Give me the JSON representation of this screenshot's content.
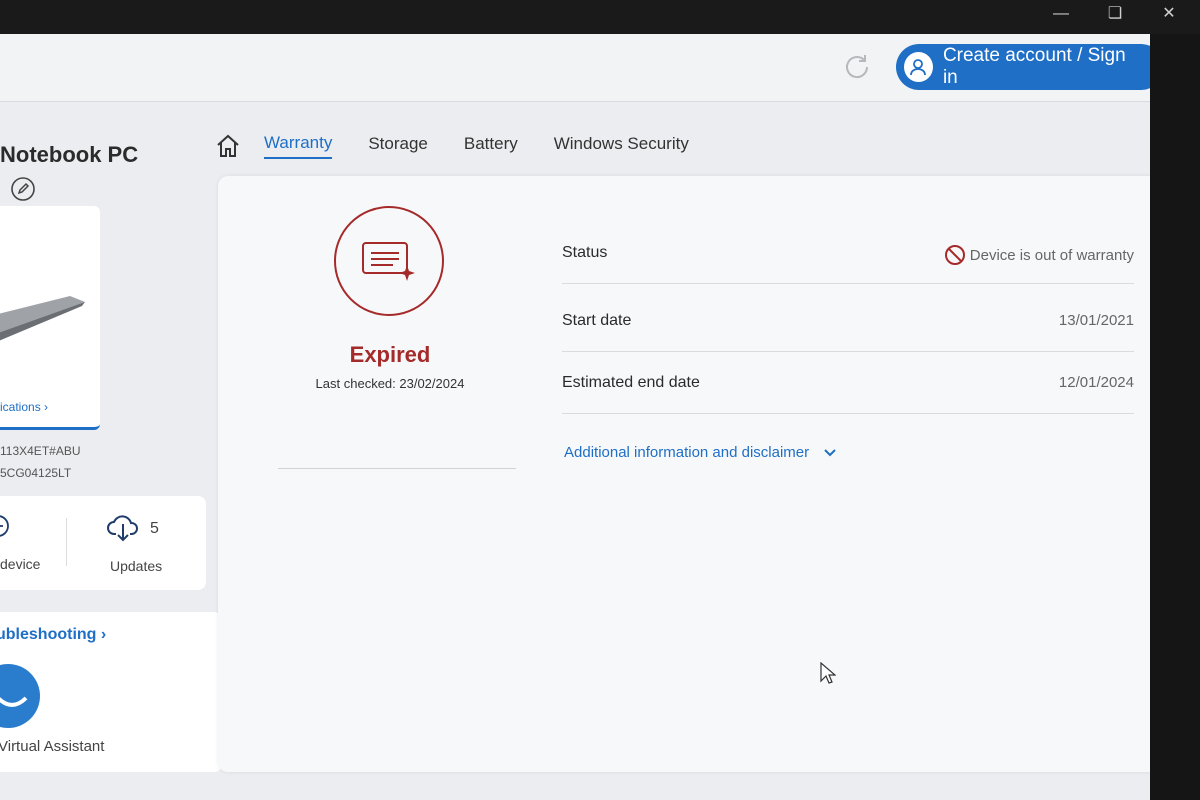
{
  "header": {
    "account_button": "Create account / Sign in"
  },
  "device": {
    "title": "Notebook PC",
    "specs_link": "ications ›",
    "product_number": "113X4ET#ABU",
    "serial_number": "5CG04125LT"
  },
  "tiles": {
    "add_device_label": "device",
    "updates_label": "Updates",
    "updates_count": "5"
  },
  "troubleshooting": {
    "title": "ubleshooting ›",
    "virtual_assistant": "Virtual Assistant"
  },
  "tabs": [
    {
      "label": "Warranty",
      "active": true
    },
    {
      "label": "Storage",
      "active": false
    },
    {
      "label": "Battery",
      "active": false
    },
    {
      "label": "Windows Security",
      "active": false
    }
  ],
  "warranty": {
    "status_title": "Expired",
    "last_checked": "Last checked: 23/02/2024",
    "rows": [
      {
        "label": "Status",
        "value": "Device is out of warranty"
      },
      {
        "label": "Start date",
        "value": "13/01/2021"
      },
      {
        "label": "Estimated end date",
        "value": "12/01/2024"
      }
    ],
    "additional_info": "Additional information and disclaimer"
  },
  "colors": {
    "accent": "#1f6fc7",
    "expired": "#a52a2a"
  },
  "icons": [
    "refresh-icon",
    "user-icon",
    "chevron-down-icon",
    "home-icon",
    "edit-icon",
    "add-icon",
    "cloud-download-icon",
    "warranty-card-icon",
    "no-entry-icon",
    "cursor-icon"
  ]
}
